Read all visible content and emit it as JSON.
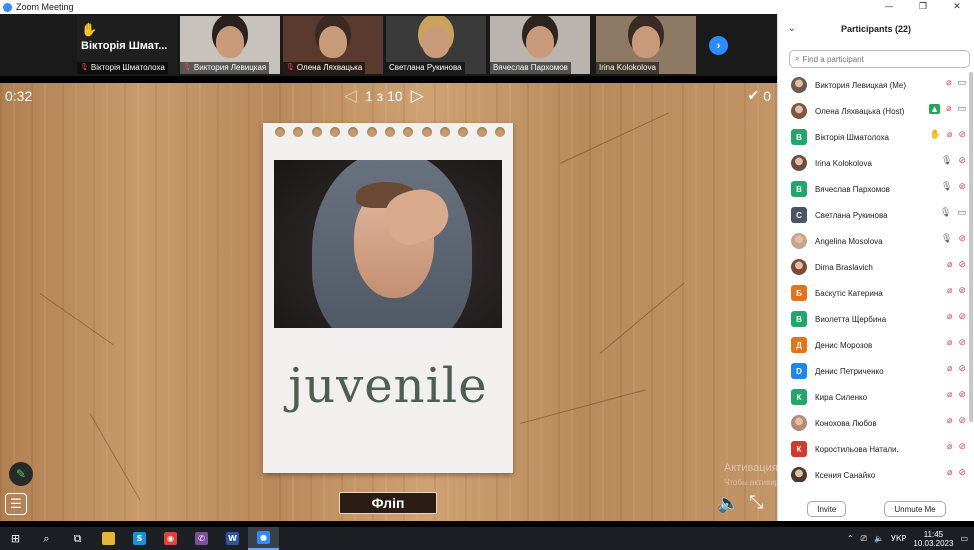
{
  "window": {
    "title": "Zoom Meeting",
    "min": "—",
    "restore": "❐",
    "close": "✕"
  },
  "strip": {
    "tiles": [
      {
        "name": "Вікторія Шматолоха",
        "big": "Вікторія Шмат...",
        "muted": true,
        "type": "text"
      },
      {
        "name": "Виктория Левицкая",
        "muted": true,
        "type": "video",
        "bg": "#c7c3bc",
        "hair": "#2a2220"
      },
      {
        "name": "Олена Ляхвацька",
        "muted": true,
        "type": "video",
        "bg": "#5a3a2e",
        "hair": "#3b2a22"
      },
      {
        "name": "Светлана Рукинова",
        "muted": false,
        "type": "video",
        "bg": "#3a3a3a",
        "hair": "#c9a25d"
      },
      {
        "name": "Вячеслав Пархомов",
        "muted": false,
        "type": "video",
        "bg": "#b9b4ad",
        "hair": "#2e2520"
      },
      {
        "name": "Irina Kolokolova",
        "muted": false,
        "type": "video",
        "bg": "#8e7a64",
        "hair": "#3a2c24",
        "active": true
      }
    ],
    "next": "›"
  },
  "stage": {
    "timer": "0:32",
    "prev": "◁",
    "page": "1 з 10",
    "next": "▷",
    "score_icon": "✔",
    "score": "0",
    "word": "juvenile",
    "flip": "Фліп",
    "pen_icon": "✎",
    "menu_icon": "☰",
    "sound_icon": "🔈",
    "fullscreen_icon": "⤡",
    "watermark": "Активация Windows",
    "watermark_sub": "Чтобы активировать Windows, перейдите в раздел \"Настройки\", щоб активувати"
  },
  "participants": {
    "title": "Participants (22)",
    "collapse": "⌄",
    "search_placeholder": "Find a participant",
    "list": [
      {
        "name": "Виктория Левицкая (Me)",
        "avatar": "img",
        "color": "#6b5a52",
        "initial": "",
        "hand": false,
        "share": false,
        "mic": "off",
        "cam": "on"
      },
      {
        "name": "Олена Ляхвацька (Host)",
        "avatar": "img",
        "color": "#7a5a44",
        "initial": "",
        "hand": false,
        "share": true,
        "mic": "off",
        "cam": "on"
      },
      {
        "name": "Вікторія Шматолоха",
        "avatar": "letter",
        "color": "#23a56b",
        "initial": "В",
        "hand": true,
        "share": false,
        "mic": "off",
        "cam": "off"
      },
      {
        "name": "Irina Kolokolova",
        "avatar": "img",
        "color": "#6a4f3e",
        "initial": "",
        "hand": false,
        "share": false,
        "mic": "on",
        "cam": "off"
      },
      {
        "name": "Вячеслав Пархомов",
        "avatar": "letter",
        "color": "#23a56b",
        "initial": "В",
        "hand": false,
        "share": false,
        "mic": "on",
        "cam": "off"
      },
      {
        "name": "Светлана Рукинова",
        "avatar": "letter",
        "color": "#4a5563",
        "initial": "С",
        "hand": false,
        "share": false,
        "mic": "on",
        "cam": "on"
      },
      {
        "name": "Angelina Mosolova",
        "avatar": "img",
        "color": "#c8a48a",
        "initial": "",
        "hand": false,
        "share": false,
        "mic": "on",
        "cam": "off"
      },
      {
        "name": "Dima Braslavich",
        "avatar": "img",
        "color": "#7a4a3a",
        "initial": "",
        "hand": false,
        "share": false,
        "mic": "off",
        "cam": "off"
      },
      {
        "name": "Баскутіс Катерина",
        "avatar": "letter",
        "color": "#e4741b",
        "initial": "Б",
        "hand": false,
        "share": false,
        "mic": "off",
        "cam": "off"
      },
      {
        "name": "Виолетта Щербина",
        "avatar": "letter",
        "color": "#23a56b",
        "initial": "В",
        "hand": false,
        "share": false,
        "mic": "off",
        "cam": "off"
      },
      {
        "name": "Денис Морозов",
        "avatar": "letter",
        "color": "#e4741b",
        "initial": "Д",
        "hand": false,
        "share": false,
        "mic": "off",
        "cam": "off"
      },
      {
        "name": "Денис Петриченко",
        "avatar": "letter",
        "color": "#1e88e5",
        "initial": "D",
        "hand": false,
        "share": false,
        "mic": "off",
        "cam": "off"
      },
      {
        "name": "Кира Силенко",
        "avatar": "letter",
        "color": "#23a56b",
        "initial": "К",
        "hand": false,
        "share": false,
        "mic": "off",
        "cam": "off"
      },
      {
        "name": "Конохова Любов",
        "avatar": "img",
        "color": "#b58a74",
        "initial": "",
        "hand": false,
        "share": false,
        "mic": "off",
        "cam": "off"
      },
      {
        "name": "Коростильова Натали.",
        "avatar": "letter",
        "color": "#d0392e",
        "initial": "К",
        "hand": false,
        "share": false,
        "mic": "off",
        "cam": "off"
      },
      {
        "name": "Ксения Санайко",
        "avatar": "img",
        "color": "#4a3a34",
        "initial": "",
        "hand": false,
        "share": false,
        "mic": "off",
        "cam": "off"
      }
    ],
    "invite": "Invite",
    "unmute": "Unmute Me"
  },
  "taskbar": {
    "icons": [
      {
        "name": "windows-start-icon",
        "glyph": "⊞",
        "color": ""
      },
      {
        "name": "search-icon",
        "glyph": "⌕",
        "color": ""
      },
      {
        "name": "task-view-icon",
        "glyph": "⧉",
        "color": ""
      },
      {
        "name": "file-explorer-icon",
        "glyph": "",
        "color": "#e8b43a"
      },
      {
        "name": "skype-icon",
        "glyph": "S",
        "color": "#1e90d8"
      },
      {
        "name": "chrome-icon",
        "glyph": "◉",
        "color": "#db4437"
      },
      {
        "name": "viber-icon",
        "glyph": "✆",
        "color": "#7b519d"
      },
      {
        "name": "word-icon",
        "glyph": "W",
        "color": "#2b579a"
      },
      {
        "name": "zoom-icon",
        "glyph": "●",
        "color": "#2d8cff",
        "active": true
      }
    ],
    "lang": "УКР",
    "time": "11:45",
    "date": "10.03.2023"
  }
}
